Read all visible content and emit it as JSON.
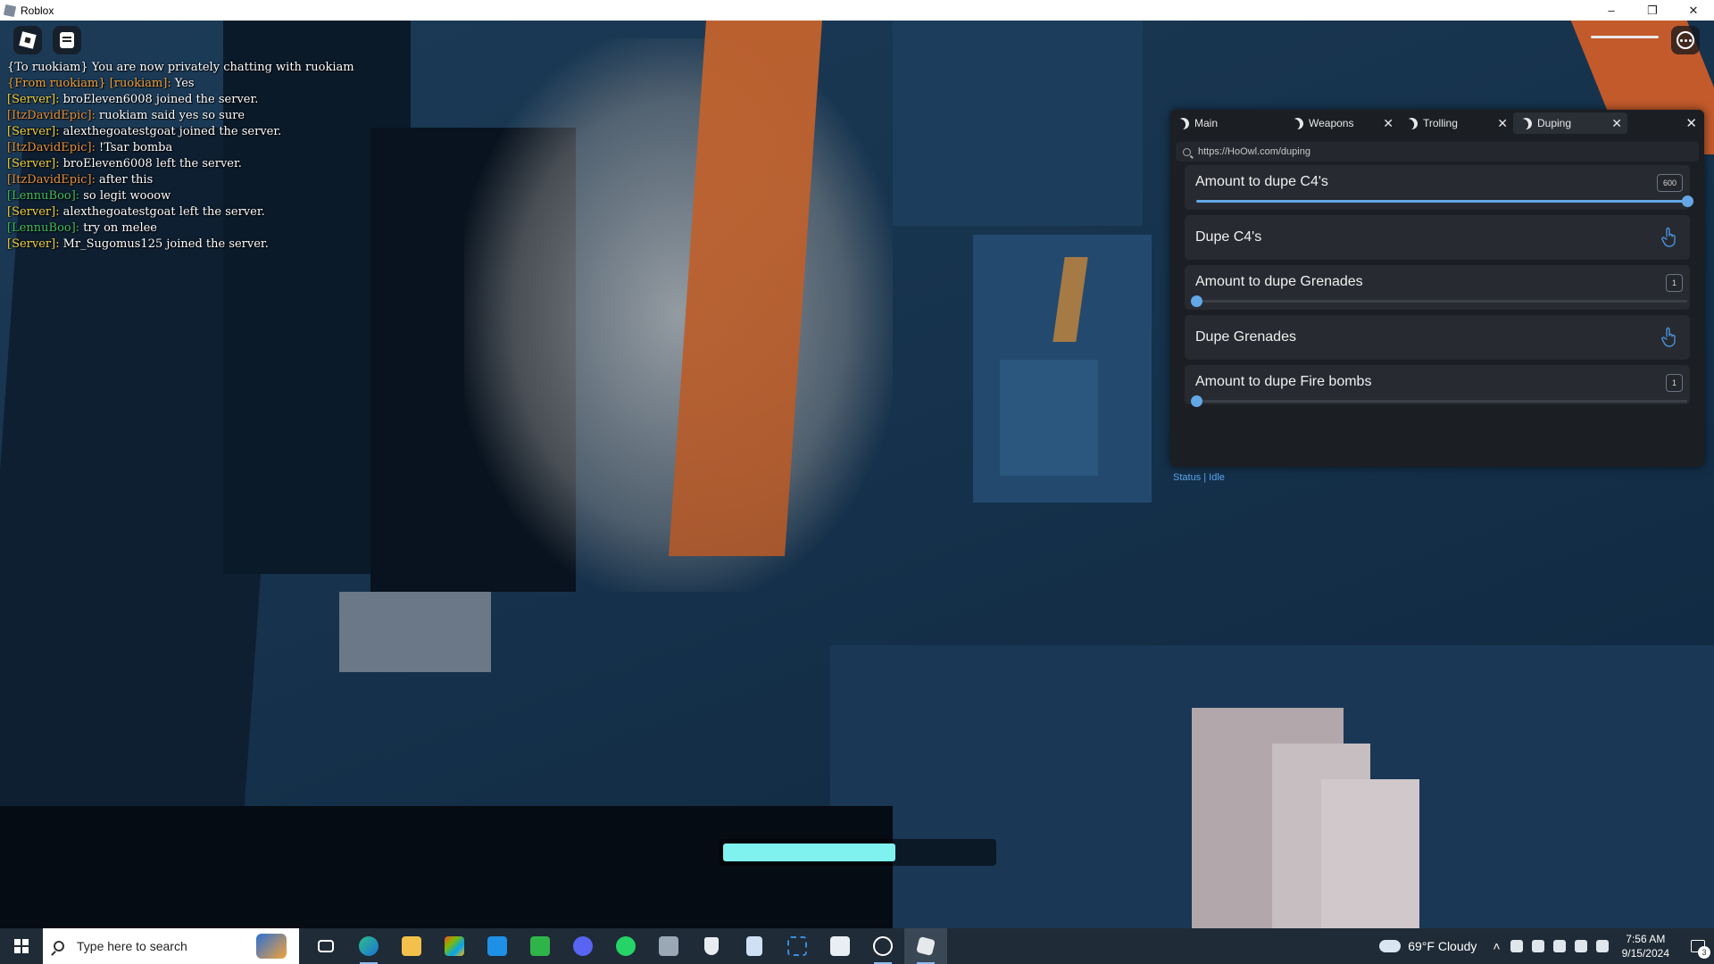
{
  "window": {
    "title": "Roblox",
    "minimize": "–",
    "restore": "❐",
    "close": "✕"
  },
  "chat": [
    {
      "speaker": "",
      "message": "{To ruokiam} You are now privately chatting with ruokiam",
      "color": "#ffffff"
    },
    {
      "speaker": "{From ruokiam} [ruokiam]:",
      "message": "Yes",
      "color": "#f0a13b"
    },
    {
      "speaker": "[Server]:",
      "message": "broEleven6008 joined the server.",
      "color": "#f2d23c"
    },
    {
      "speaker": "[ItzDavidEpic]:",
      "message": "ruokiam said yes so sure",
      "color": "#e8913a"
    },
    {
      "speaker": "[Server]:",
      "message": "alexthegoatestgoat joined the server.",
      "color": "#f2d23c"
    },
    {
      "speaker": "[ItzDavidEpic]:",
      "message": "!Tsar bomba",
      "color": "#e8913a"
    },
    {
      "speaker": "[Server]:",
      "message": "broEleven6008 left the server.",
      "color": "#f2d23c"
    },
    {
      "speaker": "[ItzDavidEpic]:",
      "message": "after this",
      "color": "#e8913a"
    },
    {
      "speaker": "[LennuBoo]:",
      "message": "so legit wooow",
      "color": "#3fbf5e"
    },
    {
      "speaker": "[Server]:",
      "message": "alexthegoatestgoat left the server.",
      "color": "#f2d23c"
    },
    {
      "speaker": "[LennuBoo]:",
      "message": "try on melee",
      "color": "#3fbf5e"
    },
    {
      "speaker": "[Server]:",
      "message": "Mr_Sugomus125 joined the server.",
      "color": "#f2d23c"
    }
  ],
  "gui": {
    "tabs": [
      {
        "label": "Main",
        "close": ""
      },
      {
        "label": "Weapons",
        "close": "✕"
      },
      {
        "label": "Trolling",
        "close": "✕"
      },
      {
        "label": "Duping",
        "close": "✕"
      }
    ],
    "close": "✕",
    "url": "https://HoOwl.com/duping",
    "rows": [
      {
        "label": "Amount to dupe C4's",
        "value": "600",
        "fill": 1.0
      },
      {
        "label": "Dupe C4's"
      },
      {
        "label": "Amount to dupe Grenades",
        "value": "1",
        "fill": 0.0
      },
      {
        "label": "Dupe Grenades"
      },
      {
        "label": "Amount to dupe Fire bombs",
        "value": "1",
        "fill": 0.0
      }
    ],
    "status": "Status | Idle",
    "accent": "#63a7e6"
  },
  "progress": {
    "fraction": 0.64,
    "color": "#7ff1ee"
  },
  "taskbar": {
    "search_placeholder": "Type here to search",
    "weather": "69°F  Cloudy",
    "time": "7:56 AM",
    "date": "9/15/2024",
    "notifications": "3",
    "apps": [
      "task-view",
      "edge",
      "file-explorer",
      "microsoft-store",
      "mail",
      "h-app",
      "discord",
      "whatsapp",
      "app-7",
      "security",
      "notepad",
      "snipping-tool",
      "app-12",
      "roblox-studio",
      "roblox"
    ]
  }
}
